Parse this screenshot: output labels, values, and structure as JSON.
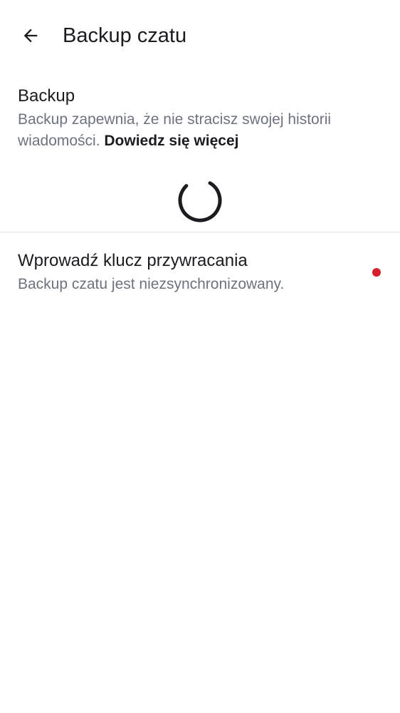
{
  "header": {
    "back_icon": "arrow-back-icon",
    "title": "Backup czatu"
  },
  "backup": {
    "title": "Backup",
    "description": "Backup zapewnia, że nie stracisz swojej historii wiadomości.",
    "learn_more": "Dowiedz się więcej",
    "loading": true,
    "spinner_icon": "loading-spinner-icon"
  },
  "restore_key": {
    "title": "Wprowadź klucz przywracania",
    "subtitle": "Backup czatu jest niezsynchronizowany.",
    "status_dot_color": "#d61f2c",
    "status_icon": "alert-dot-icon"
  },
  "colors": {
    "text_primary": "#1c1b1f",
    "text_secondary": "#6e7280",
    "divider": "#e4e4e6",
    "alert": "#d61f2c"
  }
}
